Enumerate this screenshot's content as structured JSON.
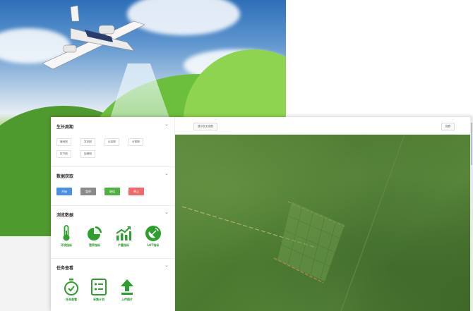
{
  "panel": {
    "cycle": {
      "title": "生长周期",
      "stages": [
        "播种期",
        "发芽期",
        "出苗期",
        "分蘖期",
        "拔节期",
        "抽穗期"
      ]
    },
    "acquire": {
      "title": "数据获取",
      "buttons": [
        {
          "label": "开始",
          "color": "#4a90e2"
        },
        {
          "label": "暂停",
          "color": "#8a8a8a"
        },
        {
          "label": "继续",
          "color": "#52b043"
        },
        {
          "label": "停止",
          "color": "#f06a6a"
        }
      ]
    },
    "browse": {
      "title": "浏览数据",
      "items": [
        {
          "label": "环境指标",
          "icon": "thermometer-icon"
        },
        {
          "label": "营养指标",
          "icon": "pie-chart-icon"
        },
        {
          "label": "产量指标",
          "icon": "trend-chart-icon"
        },
        {
          "label": "LOT指标",
          "icon": "satellite-dish-icon"
        }
      ]
    },
    "tasks": {
      "title": "任务查看",
      "items": [
        {
          "label": "任务查看",
          "icon": "timer-check-icon"
        },
        {
          "label": "采集计划",
          "icon": "checklist-icon"
        },
        {
          "label": "上传图片",
          "icon": "upload-icon"
        }
      ]
    }
  },
  "map": {
    "toolbar": {
      "left_label": "显示农业全图",
      "right_label": "回退"
    }
  },
  "colors": {
    "accent_green": "#2e9e2e"
  }
}
